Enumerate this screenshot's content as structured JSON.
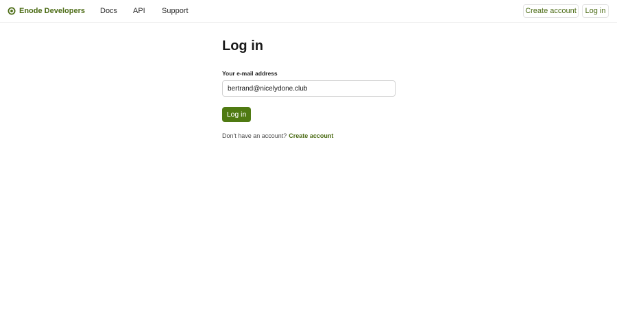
{
  "nav": {
    "brand_name": "Enode Developers",
    "brand_icon": "enode-logo-icon",
    "links": {
      "docs": "Docs",
      "api": "API",
      "support": "Support"
    },
    "create_account": "Create account",
    "log_in": "Log in"
  },
  "login": {
    "title": "Log in",
    "email_label": "Your e-mail address",
    "email_value": "bertrand@nicelydone.club",
    "submit_label": "Log in",
    "no_account_text": "Don't have an account?",
    "create_account_link": "Create account"
  },
  "colors": {
    "accent": "#4b6b14",
    "button_bg": "#4f7a12",
    "border": "#d4d4d4"
  }
}
